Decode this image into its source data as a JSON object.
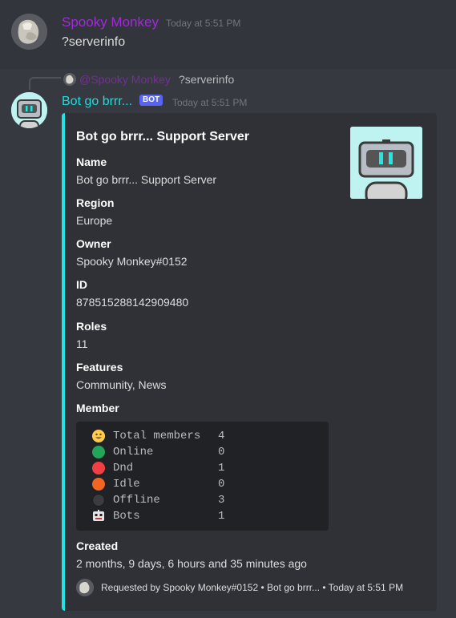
{
  "message1": {
    "author": "Spooky Monkey",
    "timestamp": "Today at 5:51 PM",
    "content": "?serverinfo"
  },
  "reply": {
    "mention": "@Spooky Monkey",
    "content": "?serverinfo"
  },
  "message2": {
    "author": "Bot go brrr...",
    "bot_tag": "BOT",
    "timestamp": "Today at 5:51 PM"
  },
  "embed": {
    "accent_color": "#1fe4e4",
    "title": "Bot go brrr... Support Server",
    "fields": {
      "name_label": "Name",
      "name_value": "Bot go brrr... Support Server",
      "region_label": "Region",
      "region_value": "Europe",
      "owner_label": "Owner",
      "owner_value": "Spooky Monkey#0152",
      "id_label": "ID",
      "id_value": "878515288142909480",
      "roles_label": "Roles",
      "roles_value": "11",
      "features_label": "Features",
      "features_value": "Community, News",
      "member_label": "Member",
      "created_label": "Created",
      "created_value": "2 months, 9 days, 6 hours and 35 minutes ago"
    },
    "member_stats": [
      {
        "icon": "smiley-icon",
        "color": "#ffcc4d",
        "label": "Total members",
        "value": "4"
      },
      {
        "icon": "online-status-icon",
        "color": "#23a55a",
        "label": "Online",
        "value": "0"
      },
      {
        "icon": "dnd-status-icon",
        "color": "#f23f43",
        "label": "Dnd",
        "value": "1"
      },
      {
        "icon": "idle-status-icon",
        "color": "#f26522",
        "label": "Idle",
        "value": "0"
      },
      {
        "icon": "offline-status-icon",
        "color": "#3a3c40",
        "label": "Offline",
        "value": "3"
      },
      {
        "icon": "robot-icon",
        "color": "#ffffff",
        "label": "Bots",
        "value": "1"
      }
    ],
    "footer": "Requested by Spooky Monkey#0152 • Bot go brrr... • Today at 5:51 PM"
  },
  "colors": {
    "background": "#36393f",
    "embed_background": "#2f3136",
    "spooky_name": "#a12bd8",
    "bot_name": "#19dfe0",
    "bot_tag": "#5865f2"
  }
}
